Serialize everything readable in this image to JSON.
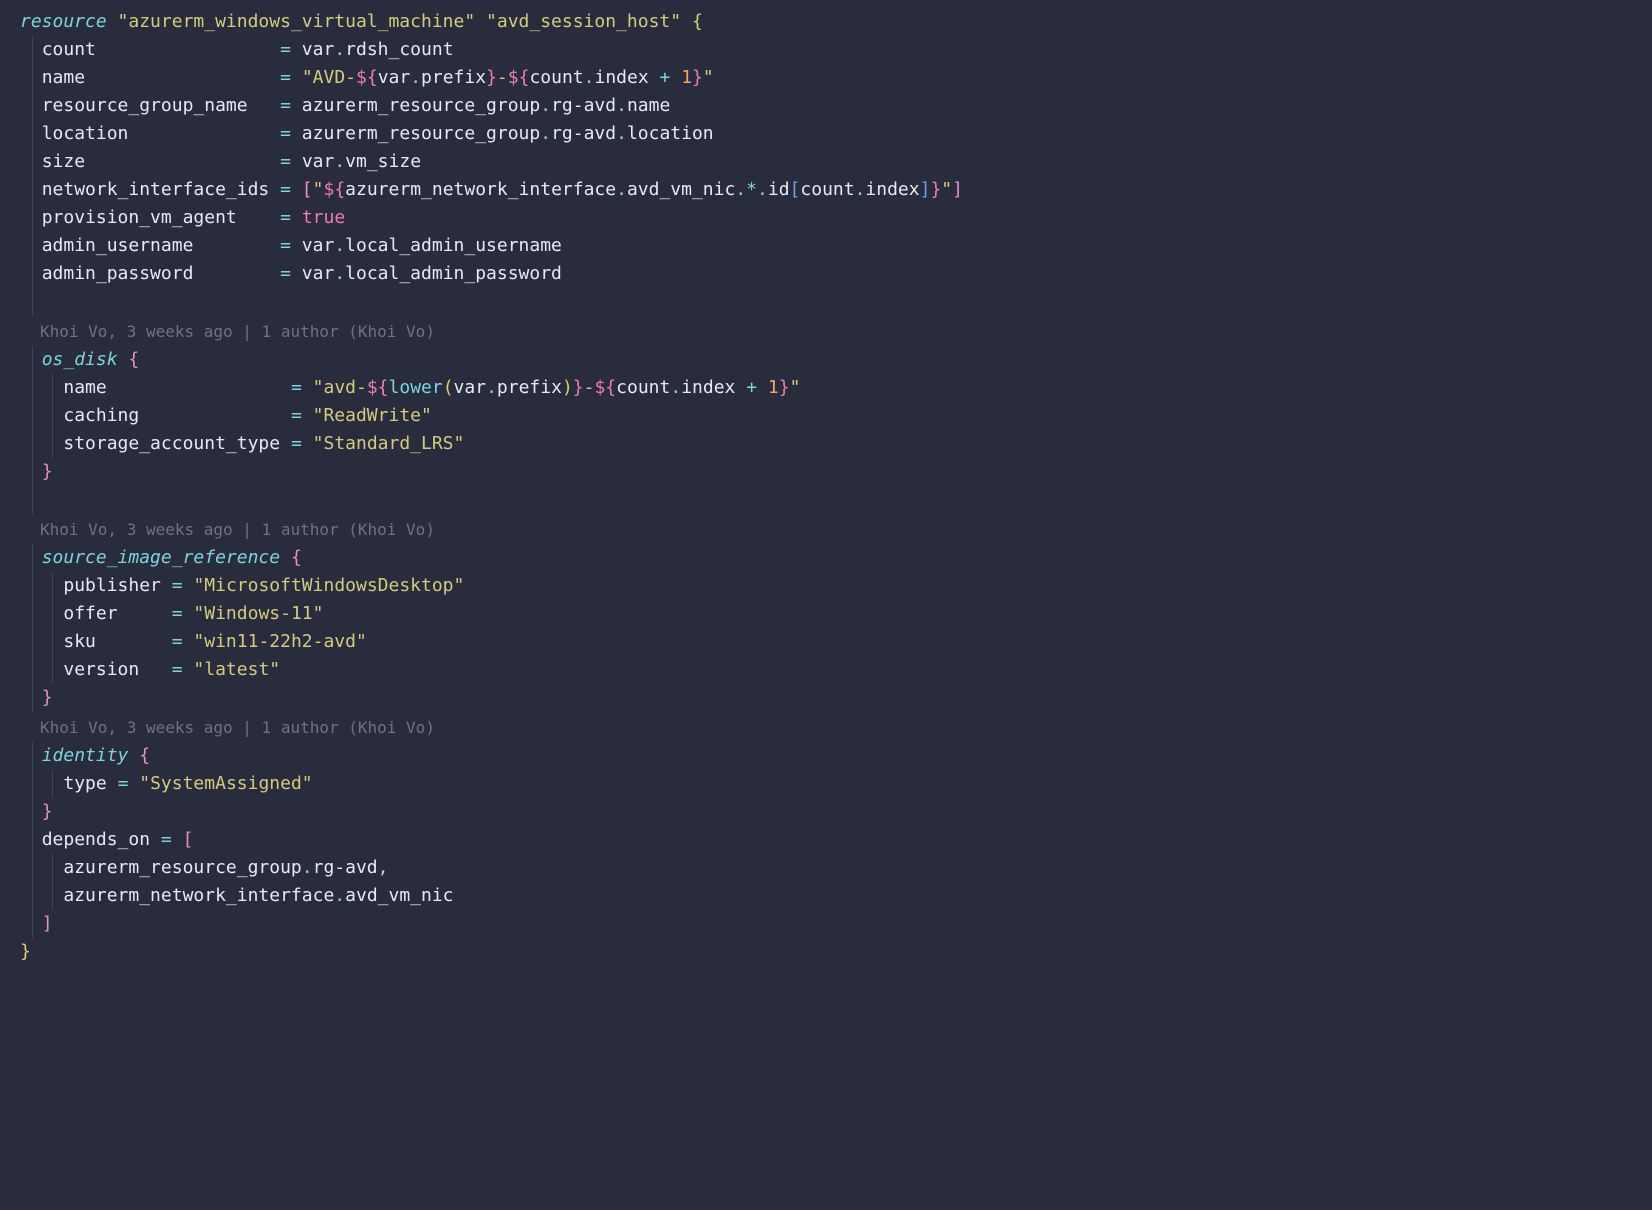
{
  "resource_keyword": "resource",
  "resource_type": "\"azurerm_windows_virtual_machine\"",
  "resource_name": "\"avd_session_host\"",
  "count_key": "count",
  "count_val_var": "var",
  "count_val_field": "rdsh_count",
  "name_key": "name",
  "name_val": "\"AVD-${var.prefix}-${count.index + 1}\"",
  "rg_key": "resource_group_name",
  "rg_val": "azurerm_resource_group.rg-avd.name",
  "loc_key": "location",
  "loc_val": "azurerm_resource_group.rg-avd.location",
  "size_key": "size",
  "size_val": "var.vm_size",
  "nic_key": "network_interface_ids",
  "nic_val": "[\"${azurerm_network_interface.avd_vm_nic.*.id[count.index]}\"]",
  "pva_key": "provision_vm_agent",
  "pva_val": "true",
  "au_key": "admin_username",
  "au_val": "var.local_admin_username",
  "ap_key": "admin_password",
  "ap_val": "var.local_admin_password",
  "blame1": "Khoi Vo, 3 weeks ago | 1 author (Khoi Vo)",
  "osdisk_key": "os_disk",
  "osdisk_name_key": "name",
  "osdisk_name_val": "\"avd-${lower(var.prefix)}-${count.index + 1}\"",
  "osdisk_caching_key": "caching",
  "osdisk_caching_val": "\"ReadWrite\"",
  "osdisk_sat_key": "storage_account_type",
  "osdisk_sat_val": "\"Standard_LRS\"",
  "blame2": "Khoi Vo, 3 weeks ago | 1 author (Khoi Vo)",
  "sir_key": "source_image_reference",
  "sir_pub_key": "publisher",
  "sir_pub_val": "\"MicrosoftWindowsDesktop\"",
  "sir_offer_key": "offer",
  "sir_offer_val": "\"Windows-11\"",
  "sir_sku_key": "sku",
  "sir_sku_val": "\"win11-22h2-avd\"",
  "sir_ver_key": "version",
  "sir_ver_val": "\"latest\"",
  "blame3": "Khoi Vo, 3 weeks ago | 1 author (Khoi Vo)",
  "identity_key": "identity",
  "identity_type_key": "type",
  "identity_type_val": "\"SystemAssigned\"",
  "depends_key": "depends_on",
  "depends_1": "azurerm_resource_group.rg-avd,",
  "depends_2": "azurerm_network_interface.avd_vm_nic"
}
